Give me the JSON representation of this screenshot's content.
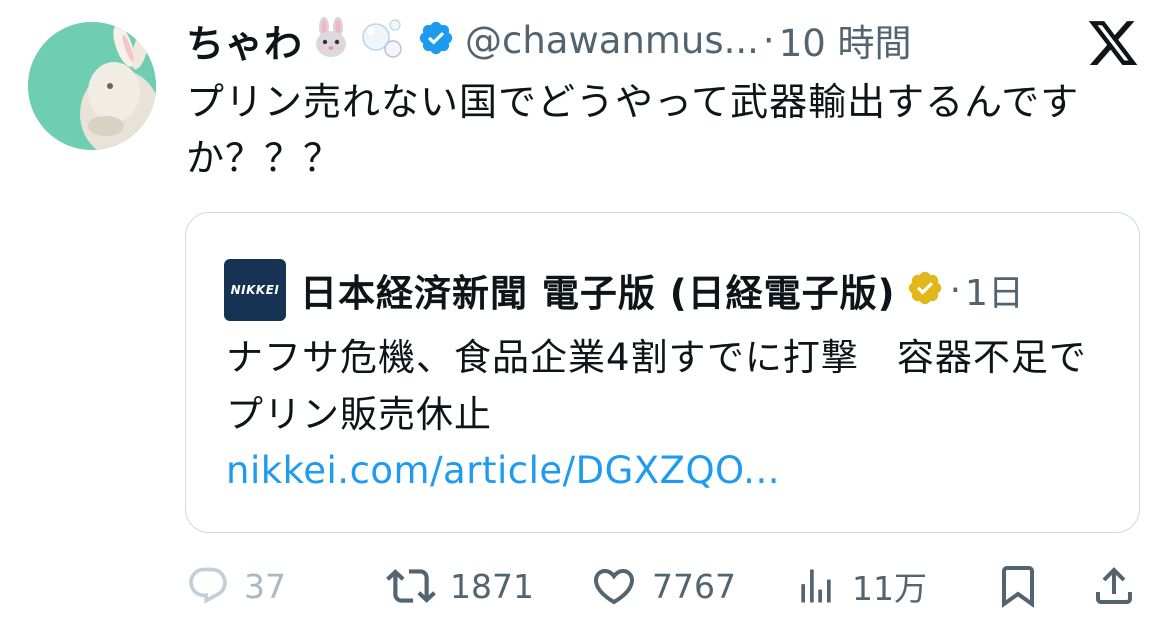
{
  "tweet": {
    "display_name": "ちゃわ",
    "name_emoji": [
      "rabbit-face-emoji",
      "bubbles-emoji"
    ],
    "handle": "@chawanmus...",
    "separator": "·",
    "time": "10 時間",
    "text": "プリン売れない国でどうやって武器輸出するんですか？？？"
  },
  "quote": {
    "logo_text": "NIKKEI",
    "author": "日本経済新聞 電子版 (日経電子版)",
    "separator": "·",
    "time": "1日",
    "text": "ナフサ危機、食品企業4割すでに打撃　容器不足でプリン販売休止",
    "link": "nikkei.com/article/DGXZQO..."
  },
  "actions": {
    "reply_count": "37",
    "retweet_count": "1871",
    "like_count": "7767",
    "views_count": "11万"
  },
  "colors": {
    "text": "#0f1419",
    "secondary": "#536471",
    "link": "#1d9bf0",
    "verified_blue": "#1d9bf0",
    "verified_gold": "#e2b719",
    "avatar_bg": "#6fcdb1",
    "nikkei_blue": "#163354"
  }
}
